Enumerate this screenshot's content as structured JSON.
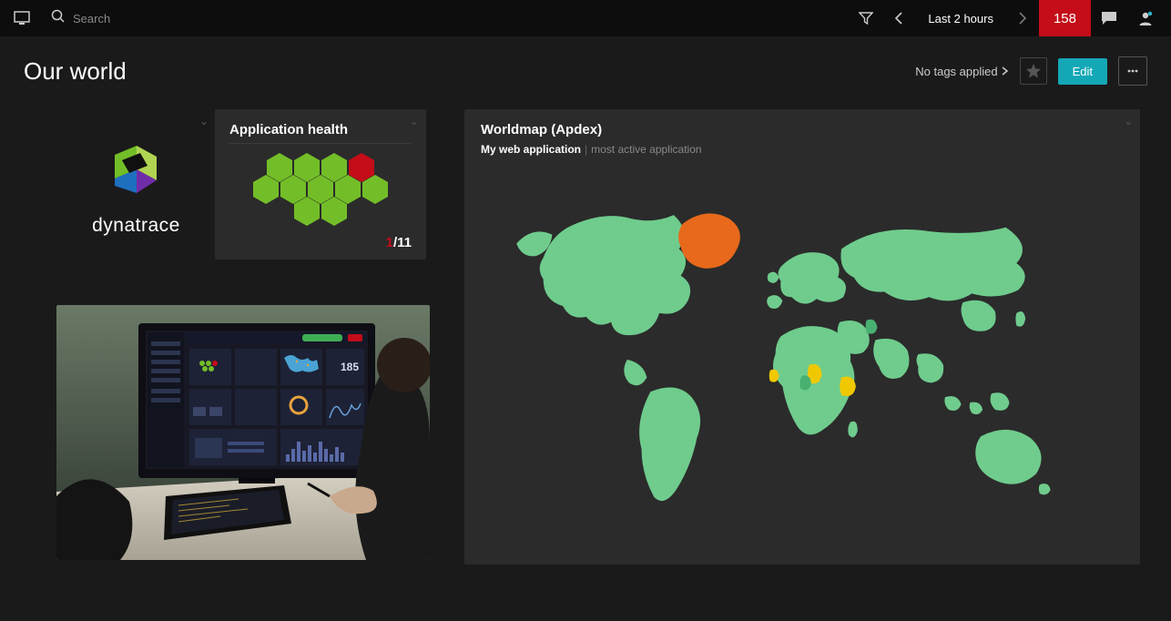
{
  "topbar": {
    "search_placeholder": "Search",
    "time_label": "Last 2 hours",
    "problems_count": "158"
  },
  "page": {
    "title": "Our world",
    "tags_label": "No tags applied",
    "edit_label": "Edit"
  },
  "tiles": {
    "logo": {
      "brand": "dynatrace"
    },
    "health": {
      "title": "Application health",
      "cells": [
        [
          "ok",
          "ok",
          "ok",
          "bad"
        ],
        [
          "ok",
          "ok",
          "ok",
          "ok",
          "ok"
        ],
        [
          "ok",
          "ok"
        ]
      ],
      "bad_count": "1",
      "total_count": "/11",
      "colors": {
        "ok": "#73be28",
        "bad": "#c40d19"
      }
    },
    "map": {
      "title": "Worldmap (Apdex)",
      "app_name": "My web application",
      "note": "most active application",
      "colors": {
        "land": "#6fcc8d",
        "warn": "#f0c800",
        "bad": "#e8691b",
        "ocean": "#2b2b2b"
      }
    }
  }
}
